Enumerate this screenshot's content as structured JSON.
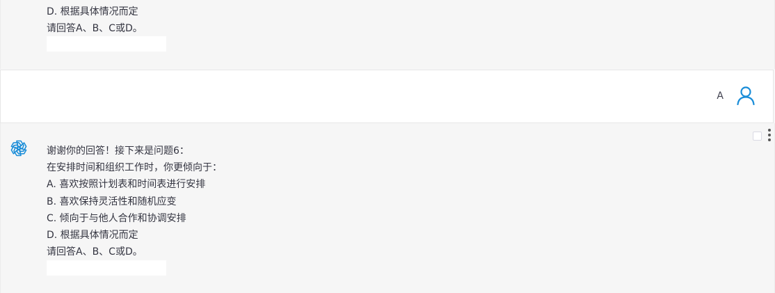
{
  "previous_message": {
    "lines": [
      "D. 根据具体情况而定",
      "请回答A、B、C或D。"
    ]
  },
  "user_message": {
    "text": "A",
    "avatar_icon": "user-icon"
  },
  "assistant_message": {
    "avatar_icon": "openai-logo-icon",
    "lines": [
      "谢谢你的回答！接下来是问题6：",
      "在安排时间和组织工作时，你更倾向于：",
      "A. 喜欢按照计划表和时间表进行安排",
      "B. 喜欢保持灵活性和随机应变",
      "C. 倾向于与他人合作和协调安排",
      "D. 根据具体情况而定",
      "请回答A、B、C或D。"
    ]
  },
  "colors": {
    "accent": "#1a8dd8",
    "assistant_bg": "#f6f6f6",
    "user_bg": "#ffffff"
  }
}
